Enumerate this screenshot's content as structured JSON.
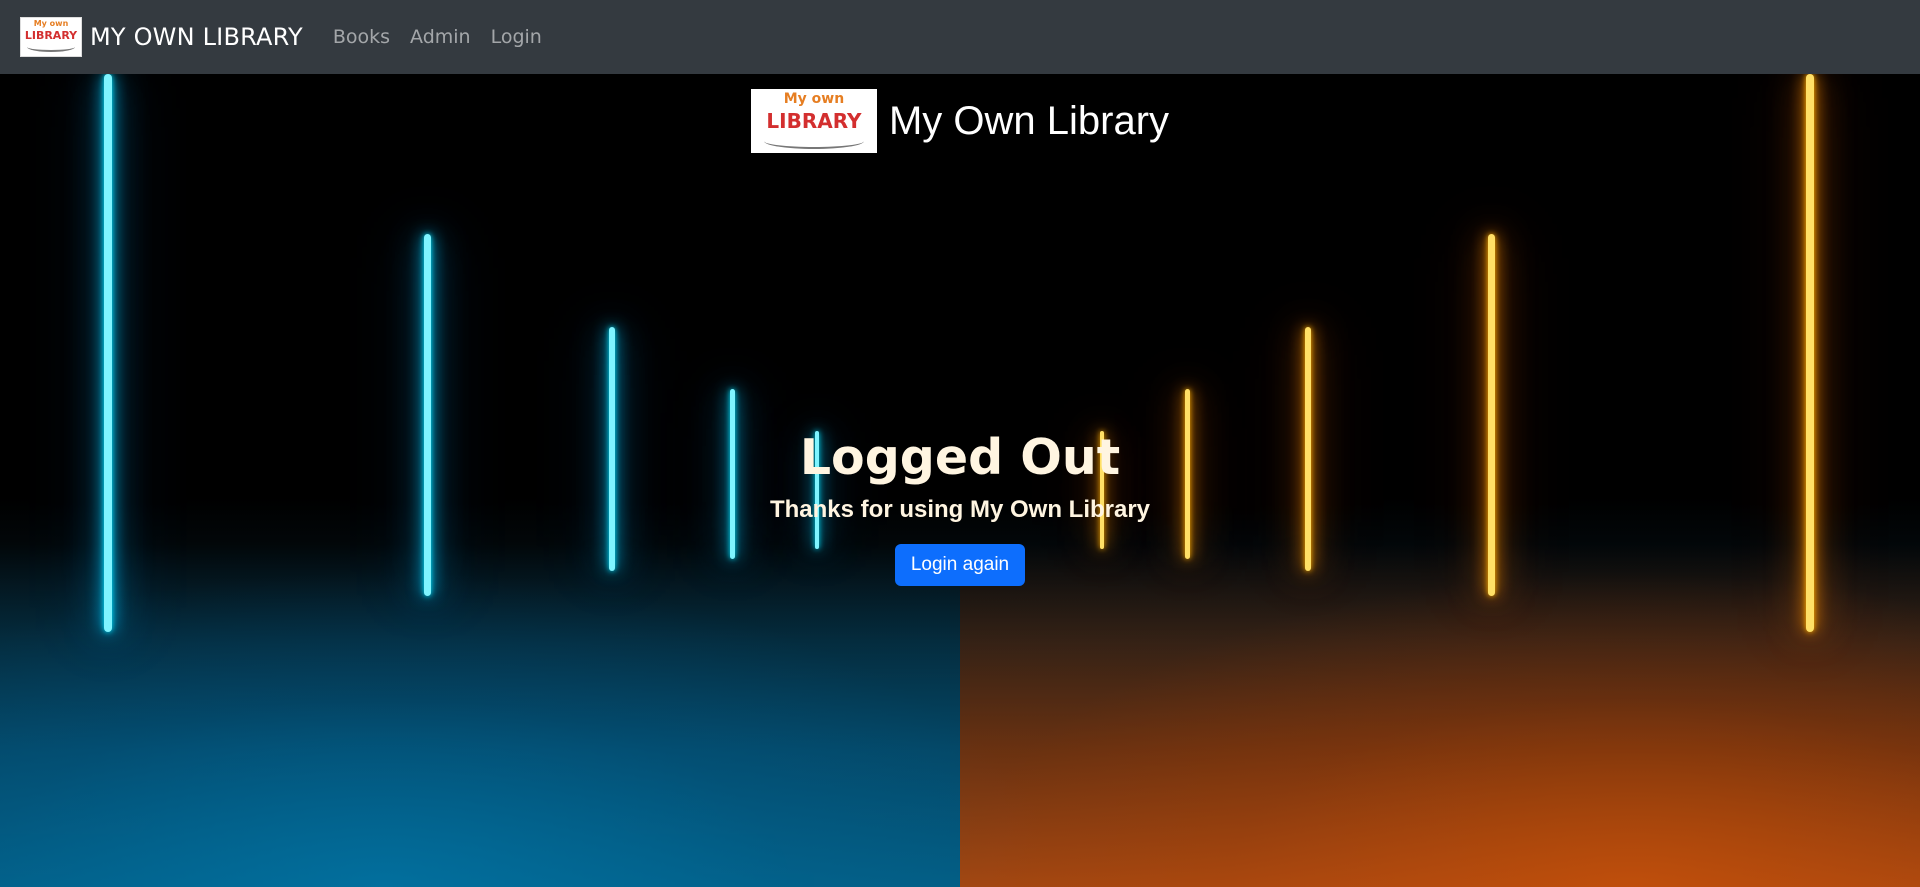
{
  "navbar": {
    "brand": "MY OWN LIBRARY",
    "links": [
      "Books",
      "Admin",
      "Login"
    ],
    "background": "#343a40"
  },
  "logo": {
    "line1": "My own",
    "line2": "LIBRARY",
    "icon": "open-book-logo"
  },
  "hero": {
    "site_title": "My Own Library",
    "heading": "Logged Out",
    "subheading": "Thanks for using My Own Library",
    "button_label": "Login again",
    "button_color": "#0d6efd",
    "text_color": "#fff5e1",
    "neon_colors": [
      "#00e5ff",
      "#ff9000"
    ]
  }
}
